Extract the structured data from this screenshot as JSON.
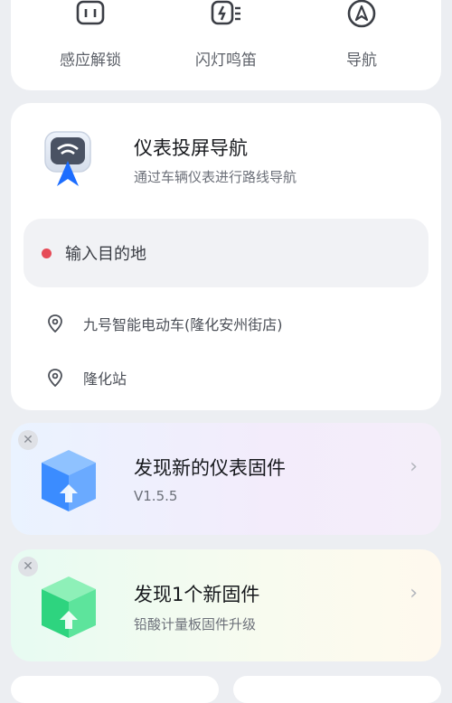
{
  "quick_actions": [
    {
      "label": "感应解锁",
      "icon": "sensor-unlock-icon"
    },
    {
      "label": "闪灯鸣笛",
      "icon": "flash-horn-icon"
    },
    {
      "label": "导航",
      "icon": "navigation-icon"
    }
  ],
  "nav_card": {
    "title": "仪表投屏导航",
    "subtitle": "通过车辆仪表进行路线导航",
    "destination_placeholder": "输入目的地",
    "places": [
      "九号智能电动车(隆化安州街店)",
      "隆化站"
    ]
  },
  "firmware_cards": [
    {
      "title": "发现新的仪表固件",
      "subtitle": "V1.5.5"
    },
    {
      "title": "发现1个新固件",
      "subtitle": "铅酸计量板固件升级"
    }
  ],
  "colors": {
    "background": "#eceef2",
    "accent_dot": "#e64b57",
    "nav_arrow": "#1c6dff",
    "cube_blue": "#3b8cff",
    "cube_green": "#2ed47f"
  }
}
